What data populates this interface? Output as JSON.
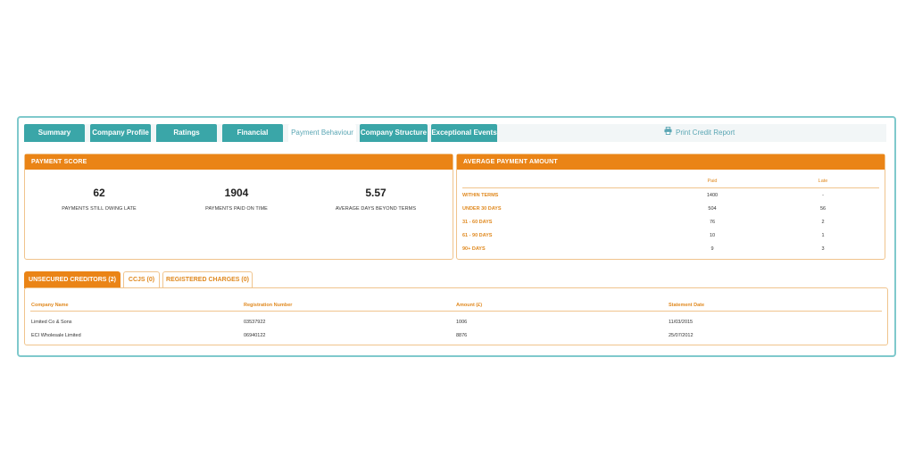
{
  "tabs": [
    {
      "label": "Summary",
      "active": false
    },
    {
      "label": "Company Profile",
      "active": false
    },
    {
      "label": "Ratings",
      "active": false
    },
    {
      "label": "Financial",
      "active": false
    },
    {
      "label": "Payment Behaviour",
      "active": true
    },
    {
      "label": "Company Structure",
      "active": false
    },
    {
      "label": "Exceptional Events",
      "active": false
    }
  ],
  "print_label": "Print Credit Report",
  "payment_score": {
    "title": "PAYMENT SCORE",
    "items": [
      {
        "value": "62",
        "label": "PAYMENTS STILL OWING LATE"
      },
      {
        "value": "1904",
        "label": "PAYMENTS PAID ON TIME"
      },
      {
        "value": "5.57",
        "label": "AVERAGE DAYS BEYOND TERMS"
      }
    ]
  },
  "average_payment": {
    "title": "AVERAGE PAYMENT AMOUNT",
    "headers": {
      "paid": "Paid",
      "late": "Late"
    },
    "rows": [
      {
        "category": "WITHIN TERMS",
        "paid": "1400",
        "late": "-"
      },
      {
        "category": "UNDER 30 DAYS",
        "paid": "504",
        "late": "56"
      },
      {
        "category": "31 - 60 DAYS",
        "paid": "76",
        "late": "2"
      },
      {
        "category": "61 - 90 DAYS",
        "paid": "10",
        "late": "1"
      },
      {
        "category": "90+ DAYS",
        "paid": "9",
        "late": "3"
      }
    ]
  },
  "creditor_tabs": [
    {
      "label": "UNSECURED CREDITORS (2)",
      "active": true
    },
    {
      "label": "CCJS (0)",
      "active": false
    },
    {
      "label": "REGISTERED CHARGES (0)",
      "active": false
    }
  ],
  "creditors": {
    "headers": [
      "Company Name",
      "Registration Number",
      "Amount (£)",
      "Statement Date"
    ],
    "rows": [
      [
        "Limited Co & Sons",
        "03537922",
        "1006",
        "11/03/2015"
      ],
      [
        "ECI Wholesale Limited",
        "06940122",
        "8876",
        "25/07/2012"
      ]
    ]
  },
  "colors": {
    "teal": "#3aa6a8",
    "orange": "#ea8416",
    "frame": "#7fc9cc"
  }
}
